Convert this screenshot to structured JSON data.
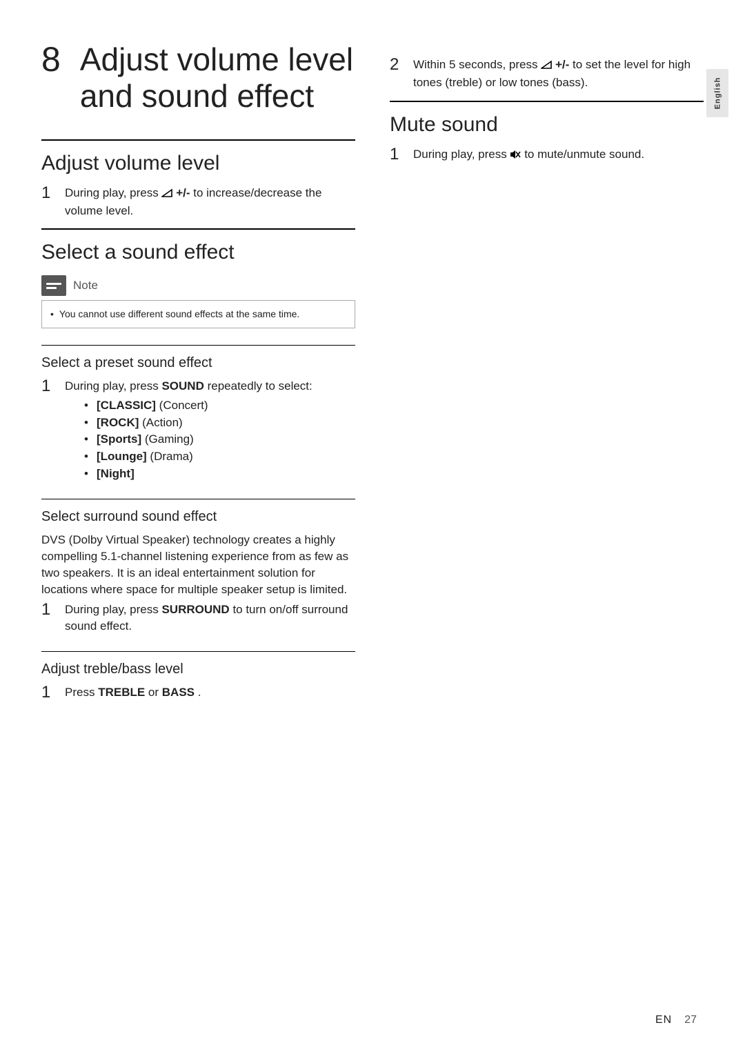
{
  "language_tab": "English",
  "chapter": {
    "number": "8",
    "title": "Adjust volume level and sound effect"
  },
  "left": {
    "adjust_volume": {
      "heading": "Adjust volume level",
      "step1_num": "1",
      "step1_pre": "During play, press ",
      "step1_btn": "+/-",
      "step1_post": " to increase/decrease the volume level."
    },
    "select_effect": {
      "heading": "Select a sound effect",
      "note_label": "Note",
      "note_text": "You cannot use different sound effects at the same time."
    },
    "preset": {
      "heading": "Select a preset sound effect",
      "step1_num": "1",
      "step1_pre": "During play, press ",
      "step1_key": "SOUND",
      "step1_post": " repeatedly to select:",
      "items": [
        {
          "code": "[CLASSIC]",
          "desc": " (Concert)"
        },
        {
          "code": "[ROCK]",
          "desc": " (Action)"
        },
        {
          "code": "[Sports]",
          "desc": " (Gaming)"
        },
        {
          "code": "[Lounge]",
          "desc": " (Drama)"
        },
        {
          "code": "[Night]",
          "desc": ""
        }
      ]
    },
    "surround": {
      "heading": "Select surround sound effect",
      "para": "DVS (Dolby Virtual Speaker) technology creates a highly compelling 5.1-channel listening experience from as few as two speakers. It is an ideal entertainment solution for locations where space for multiple speaker setup is limited.",
      "step1_num": "1",
      "step1_pre": "During play, press ",
      "step1_key": "SURROUND",
      "step1_post": " to turn on/off surround sound effect."
    },
    "treble_bass": {
      "heading": "Adjust treble/bass level",
      "step1_num": "1",
      "step1_pre": "Press ",
      "step1_key1": "TREBLE",
      "step1_or": " or ",
      "step1_key2": "BASS",
      "step1_post": "."
    }
  },
  "right": {
    "cont_step": {
      "num": "2",
      "pre": "Within 5 seconds, press ",
      "btn": "+/-",
      "post": " to set the level for high tones (treble) or low tones (bass)."
    },
    "mute": {
      "heading": "Mute sound",
      "step1_num": "1",
      "step1_pre": "During play, press ",
      "step1_post": " to mute/unmute sound."
    }
  },
  "footer": {
    "lang": "EN",
    "page": "27"
  }
}
